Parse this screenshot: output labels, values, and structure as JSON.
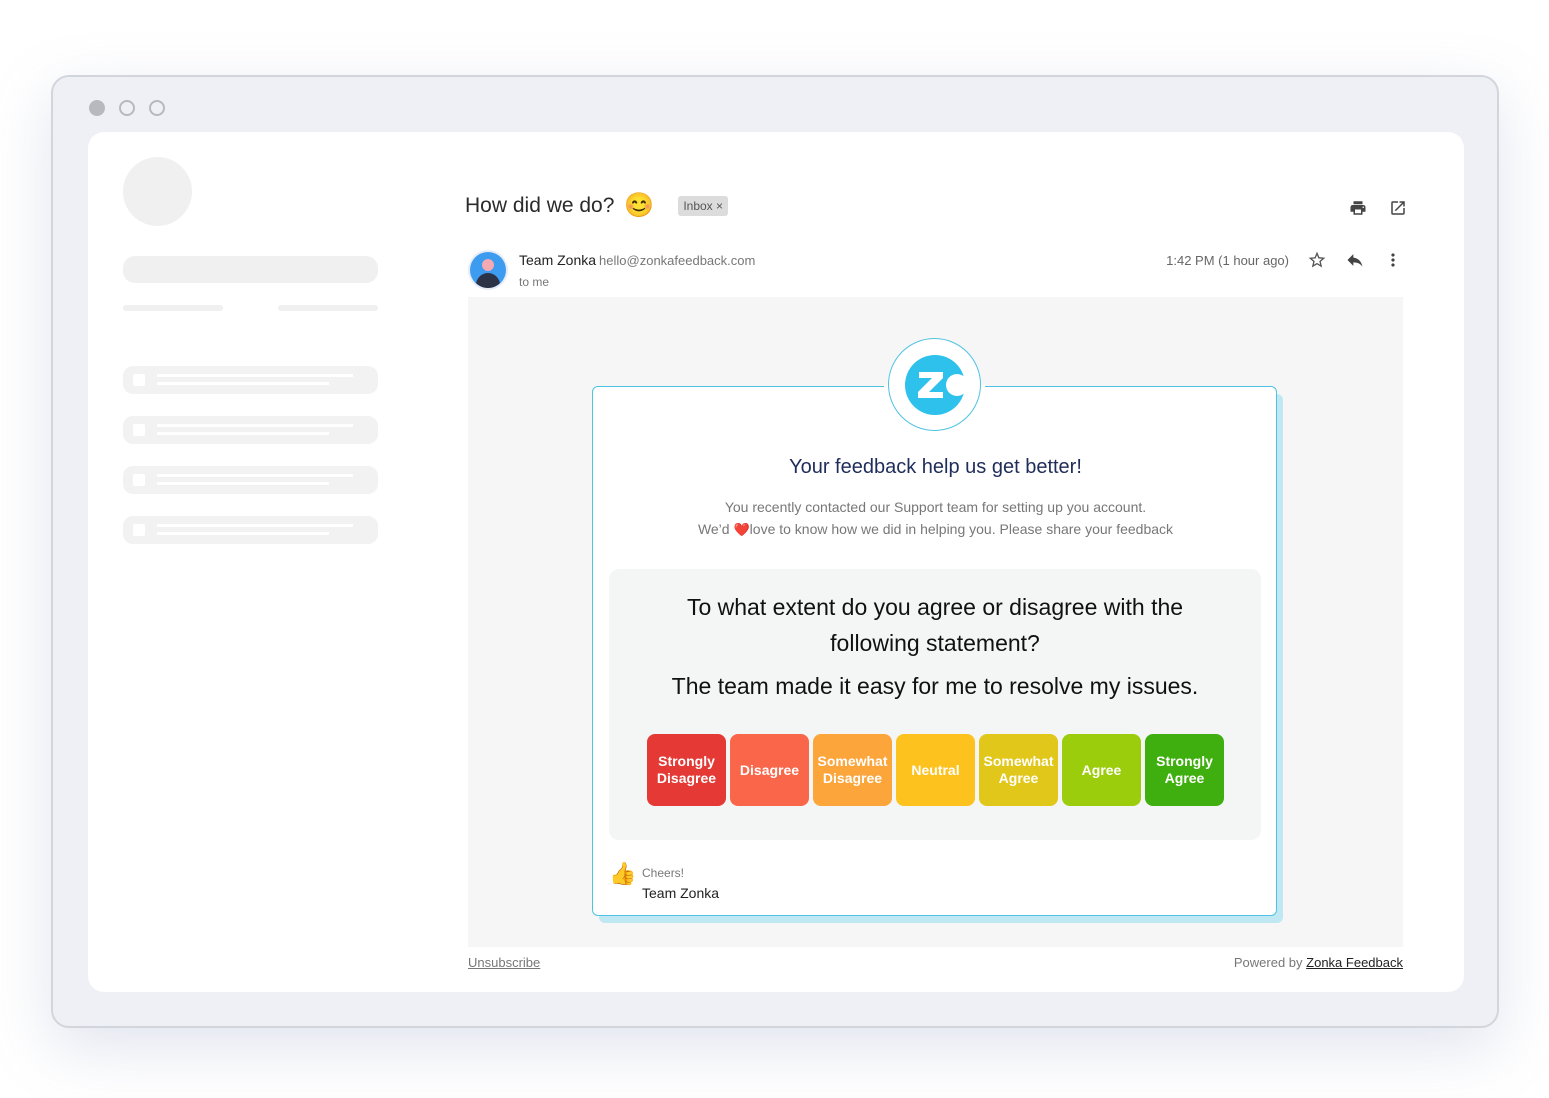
{
  "email": {
    "subject": "How did we do?",
    "subject_emoji": "😊",
    "label": "Inbox",
    "label_close": "×",
    "sender_name": "Team Zonka",
    "sender_email": "hello@zonkafeedback.com",
    "to": "to me",
    "time": "1:42 PM (1 hour ago)"
  },
  "survey": {
    "headline": "Your feedback help us get better!",
    "desc_line1": "You recently contacted our Support team for setting up you account.",
    "desc_line2_pre": "We’d",
    "desc_heart": "❤️",
    "desc_line2_post": "love to know how we did in helping you. Please share your feedback",
    "question": "To what extent do you agree or disagree with the following statement?",
    "statement": "The team made it easy for me to resolve my issues.",
    "options": [
      {
        "label": "Strongly Disagree",
        "color": "#e53935"
      },
      {
        "label": "Disagree",
        "color": "#f9664a"
      },
      {
        "label": "Somewhat Disagree",
        "color": "#fba53b"
      },
      {
        "label": "Neutral",
        "color": "#fdc21d"
      },
      {
        "label": "Somewhat Agree",
        "color": "#e0c71a"
      },
      {
        "label": "Agree",
        "color": "#9ccd0c"
      },
      {
        "label": "Strongly Agree",
        "color": "#3faf0f"
      }
    ],
    "signoff": "Cheers!",
    "team": "Team Zonka",
    "thumbs": "👍"
  },
  "footer": {
    "unsubscribe": "Unsubscribe",
    "powered_by": "Powered by",
    "brand": "Zonka Feedback"
  },
  "icons": {
    "print": "print-icon",
    "open_external": "open-external-icon",
    "star": "star-icon",
    "reply": "reply-icon",
    "more": "more-vertical-icon"
  },
  "colors": {
    "accent": "#4fc3e2",
    "logo": "#2ec1ec",
    "headline": "#1f2d5a"
  }
}
